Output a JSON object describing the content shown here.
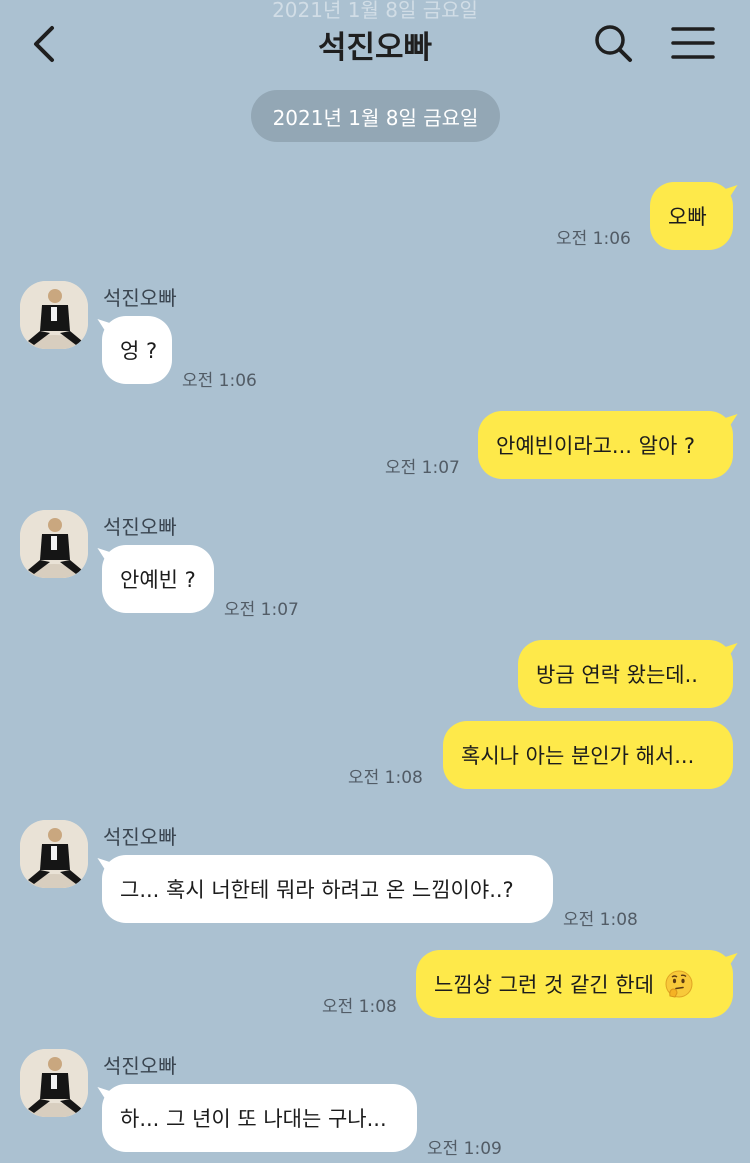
{
  "header": {
    "ghost_date": "2021년 1월 8일 금요일",
    "title": "석진오빠",
    "icons": {
      "back": "back-chevron-icon",
      "search": "search-icon",
      "menu": "hamburger-menu-icon"
    }
  },
  "date_divider": "2021년 1월 8일 금요일",
  "contact": {
    "name": "석진오빠",
    "avatar": "avatar-photo"
  },
  "colors": {
    "background": "#abc1d1",
    "my_bubble": "#fee94a",
    "their_bubble": "#ffffff",
    "date_pill": "#93a7b5"
  },
  "messages": [
    {
      "from": "me",
      "text": "오빠",
      "time": "오전 1:06"
    },
    {
      "from": "them",
      "sender": "석진오빠",
      "text": "엉 ?",
      "time": "오전 1:06"
    },
    {
      "from": "me",
      "text": "안예빈이라고... 알아 ?",
      "time": "오전 1:07"
    },
    {
      "from": "them",
      "sender": "석진오빠",
      "text": "안예빈 ?",
      "time": "오전 1:07"
    },
    {
      "from": "me",
      "text": "방금 연락 왔는데..",
      "time": ""
    },
    {
      "from": "me",
      "text": "혹시나 아는 분인가 해서...",
      "time": "오전 1:08"
    },
    {
      "from": "them",
      "sender": "석진오빠",
      "text": "그... 혹시 너한테 뭐라 하려고 온 느낌이야..?",
      "time": "오전 1:08"
    },
    {
      "from": "me",
      "text": "느낌상 그런 것 같긴 한데",
      "emoji": "thinking-face-emoji",
      "time": "오전 1:08"
    },
    {
      "from": "them",
      "sender": "석진오빠",
      "text": "하... 그 년이 또 나대는 구나...",
      "time": "오전 1:09"
    }
  ]
}
